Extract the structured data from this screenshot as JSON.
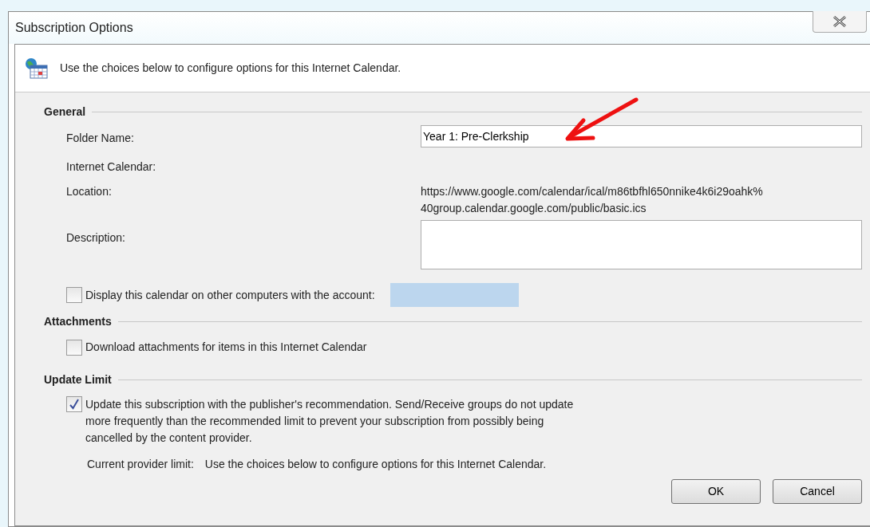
{
  "window": {
    "title": "Subscription Options"
  },
  "header": {
    "text": "Use the choices below to configure options for this Internet Calendar."
  },
  "general": {
    "heading": "General",
    "folder_name": {
      "label": "Folder Name:",
      "value": "Year 1: Pre-Clerkship"
    },
    "internet_calendar": {
      "label": "Internet Calendar:"
    },
    "location": {
      "label": "Location:",
      "lines": [
        "https://www.google.com/calendar/ical/m86tbfhl650nnike4k6i29oahk%",
        "40group.calendar.google.com/public/basic.ics"
      ]
    },
    "description": {
      "label": "Description:"
    },
    "display_on_other_computers": {
      "label": "Display this calendar on other computers with the account:",
      "checked": false
    }
  },
  "attachments": {
    "heading": "Attachments",
    "download": {
      "label": "Download attachments for items in this Internet Calendar",
      "checked": false
    }
  },
  "update_limit": {
    "heading": "Update Limit",
    "follow_recommendation": {
      "label": "Update this subscription with the publisher's recommendation. Send/Receive groups do not update more frequently than the recommended limit to prevent your subscription from possibly being cancelled by the content provider.",
      "checked": true
    },
    "current_limit": {
      "label": "Current provider limit:",
      "value": "Use the choices below to configure options for this Internet Calendar."
    }
  },
  "buttons": [
    "OK",
    "Cancel"
  ]
}
